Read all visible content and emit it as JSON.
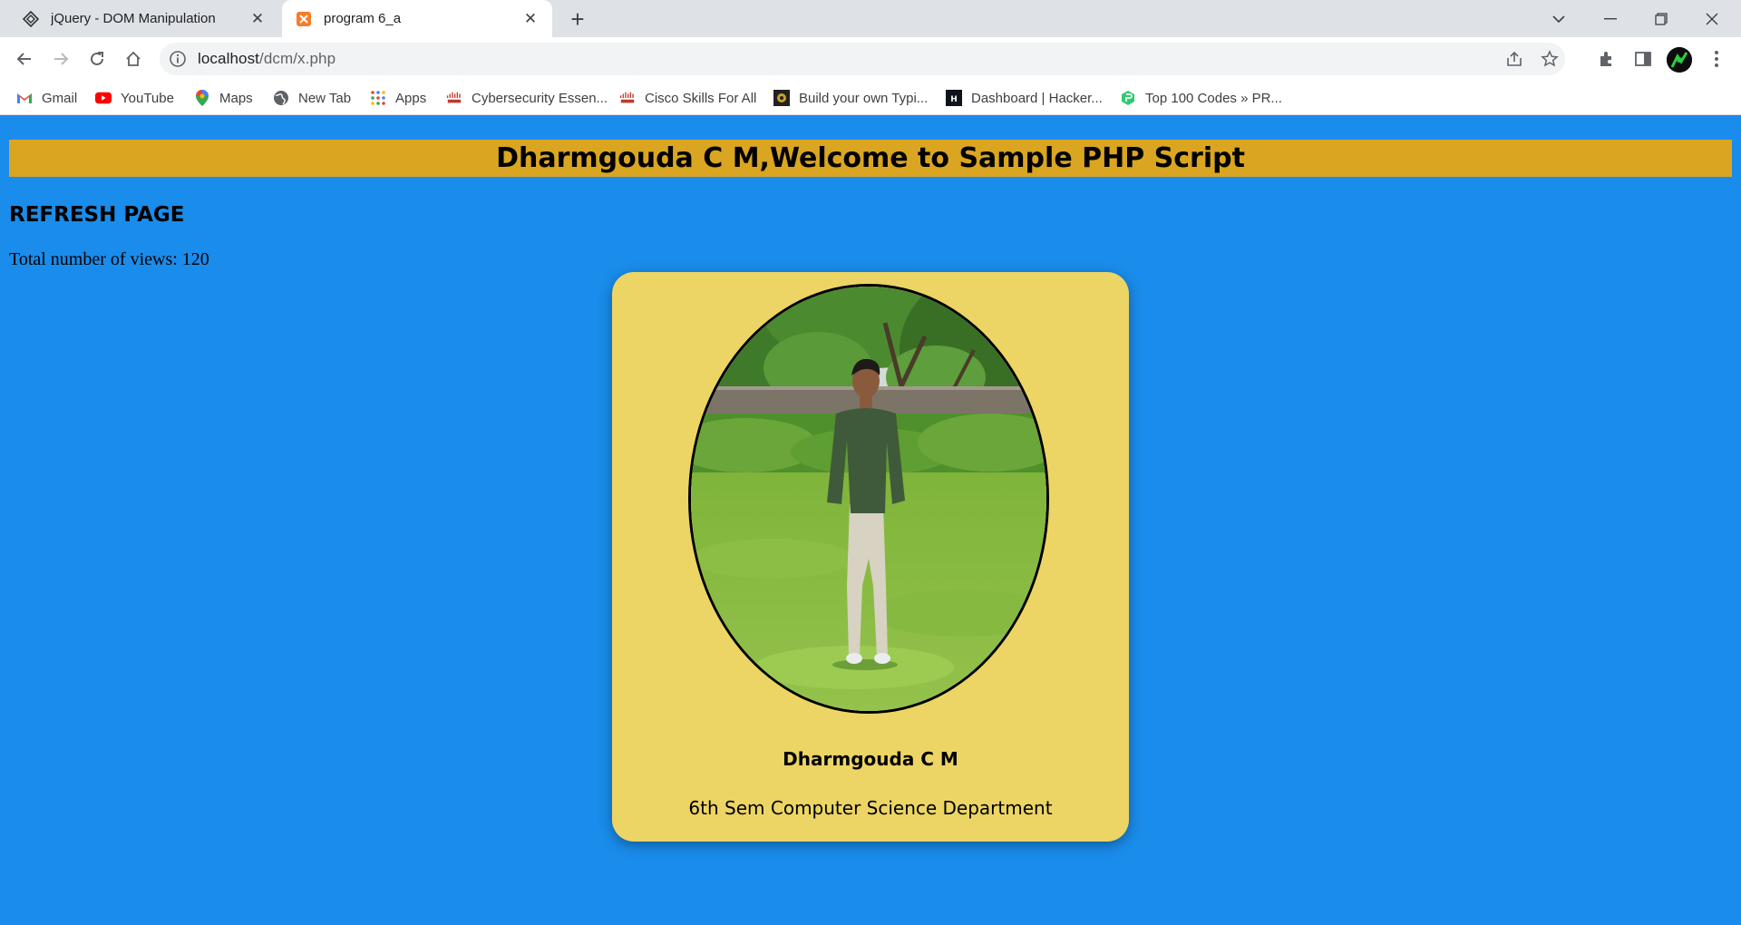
{
  "browser": {
    "tabs": [
      {
        "title": "jQuery - DOM Manipulation",
        "icon": "jquery-favicon",
        "active": false
      },
      {
        "title": "program 6_a",
        "icon": "xampp-favicon",
        "active": true
      }
    ],
    "url_host": "localhost",
    "url_path": "/dcm/x.php",
    "bookmarks": [
      {
        "label": "Gmail",
        "icon": "gmail-icon"
      },
      {
        "label": "YouTube",
        "icon": "youtube-icon"
      },
      {
        "label": "Maps",
        "icon": "maps-icon"
      },
      {
        "label": "New Tab",
        "icon": "globe-icon"
      },
      {
        "label": "Apps",
        "icon": "apps-grid-icon"
      },
      {
        "label": "Cybersecurity Essen...",
        "icon": "cisco-icon"
      },
      {
        "label": "Cisco Skills For All",
        "icon": "cisco-icon"
      },
      {
        "label": "Build your own Typi...",
        "icon": "book-icon"
      },
      {
        "label": "Dashboard | Hacker...",
        "icon": "hackerrank-icon"
      },
      {
        "label": "Top 100 Codes » PR...",
        "icon": "codes-icon"
      }
    ]
  },
  "page": {
    "banner": "Dharmgouda C M,Welcome to Sample PHP Script",
    "refresh_link": "REFRESH PAGE",
    "views_text": "Total number of views: 120",
    "card": {
      "name": "Dharmgouda C M",
      "department": "6th Sem Computer Science Department"
    }
  },
  "colors": {
    "page_bg": "#1a8ceb",
    "banner_bg": "#daa520",
    "card_bg": "#ecd564"
  }
}
